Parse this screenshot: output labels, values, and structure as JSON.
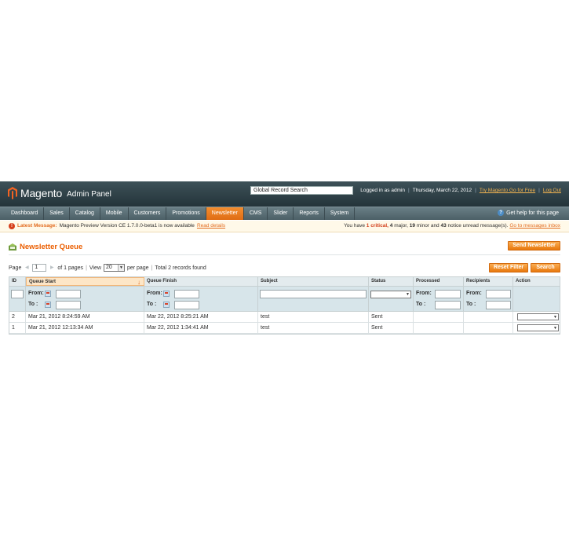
{
  "header": {
    "logo_text": "Magento",
    "logo_sub": "Admin Panel",
    "search_value": "Global Record Search",
    "logged_in": "Logged in as admin",
    "date": "Thursday, March 22, 2012",
    "try_link": "Try Magento Go for Free",
    "logout_link": "Log Out"
  },
  "nav": {
    "items": [
      "Dashboard",
      "Sales",
      "Catalog",
      "Mobile",
      "Customers",
      "Promotions",
      "Newsletter",
      "CMS",
      "Slider",
      "Reports",
      "System"
    ],
    "active": "Newsletter",
    "help": "Get help for this page"
  },
  "message": {
    "label": "Latest Message:",
    "text": "Magento Preview Version CE 1.7.0.0-beta1 is now available",
    "link": "Read details",
    "right_prefix": "You have",
    "critical_count": "1",
    "critical_label": "critical,",
    "major_count": "4",
    "major_label": "major,",
    "minor_count": "19",
    "minor_label": "minor and",
    "notice_count": "43",
    "notice_label": "notice unread message(s).",
    "messages_link": "Go to messages inbox"
  },
  "page": {
    "title": "Newsletter Queue",
    "send_button": "Send Newsletter",
    "reset_button": "Reset Filter",
    "search_button": "Search"
  },
  "pager": {
    "page_label": "Page",
    "page_value": "1",
    "of_pages": "of 1 pages",
    "view_label": "View",
    "view_value": "20",
    "per_page": "per page",
    "total": "Total 2 records found"
  },
  "grid": {
    "columns": [
      "ID",
      "Queue Start",
      "Queue Finish",
      "Subject",
      "Status",
      "Processed",
      "Recipients",
      "Action"
    ],
    "filter_from": "From:",
    "filter_to": "To :",
    "rows": [
      {
        "id": "2",
        "start": "Mar 21, 2012 8:24:59 AM",
        "finish": "Mar 22, 2012 8:25:21 AM",
        "subject": "test",
        "status": "Sent",
        "processed": "",
        "recipients": ""
      },
      {
        "id": "1",
        "start": "Mar 21, 2012 12:13:34 AM",
        "finish": "Mar 22, 2012 1:34:41 AM",
        "subject": "test",
        "status": "Sent",
        "processed": "",
        "recipients": ""
      }
    ]
  },
  "colors": {
    "accent": "#eb5e00",
    "header_bg": "#2b3a3f",
    "nav_active": "#e8780c"
  }
}
